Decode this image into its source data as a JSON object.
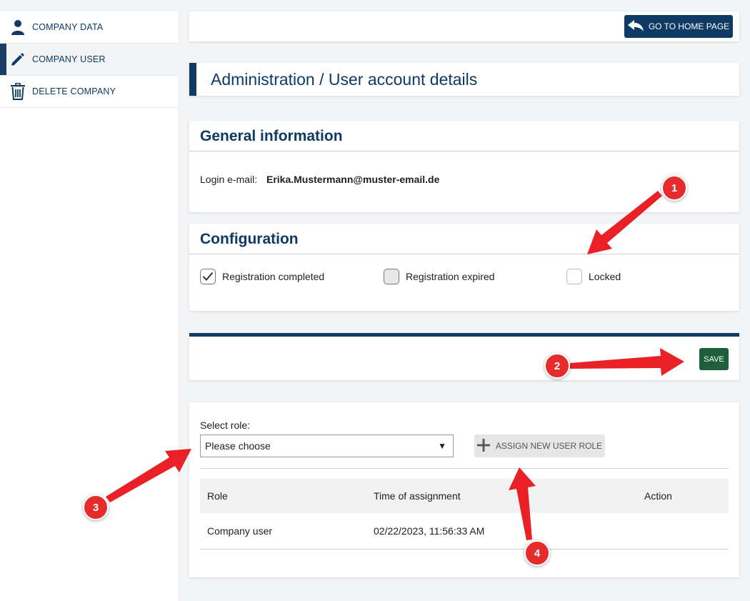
{
  "sidebar": {
    "items": [
      {
        "label": "COMPANY DATA",
        "icon": "person-icon"
      },
      {
        "label": "COMPANY USER",
        "icon": "pencil-icon"
      },
      {
        "label": "DELETE COMPANY",
        "icon": "trash-icon"
      }
    ]
  },
  "header": {
    "home_button": "GO TO HOME PAGE"
  },
  "page_title": "Administration / User account details",
  "general": {
    "title": "General information",
    "login_label": "Login e-mail:",
    "login_value": "Erika.Mustermann@muster-email.de"
  },
  "config": {
    "title": "Configuration",
    "options": [
      {
        "label": "Registration completed",
        "checked": true
      },
      {
        "label": "Registration expired",
        "checked": false
      },
      {
        "label": "Locked",
        "checked": false
      }
    ]
  },
  "save_label": "SAVE",
  "roles": {
    "select_label": "Select role:",
    "select_value": "Please choose",
    "assign_label": "ASSIGN NEW USER ROLE",
    "table": {
      "headers": [
        "Role",
        "Time of assignment",
        "Action"
      ],
      "rows": [
        [
          "Company user",
          "02/22/2023, 11:56:33 AM",
          ""
        ]
      ]
    }
  },
  "annotations": [
    "1",
    "2",
    "3",
    "4"
  ],
  "colors": {
    "primary": "#0e3a63",
    "save": "#1f5e3a",
    "annotation": "#e52b2b"
  }
}
